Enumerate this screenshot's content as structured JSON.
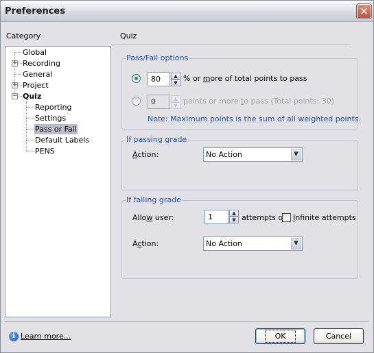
{
  "window": {
    "title": "Preferences",
    "close_icon": "close-icon"
  },
  "category": {
    "label": "Category",
    "items": [
      {
        "label": "Global",
        "level": 0,
        "expander": null
      },
      {
        "label": "Recording",
        "level": 0,
        "expander": "+"
      },
      {
        "label": "General",
        "level": 0,
        "expander": null
      },
      {
        "label": "Project",
        "level": 0,
        "expander": "+"
      },
      {
        "label": "Quiz",
        "level": 0,
        "expander": "-",
        "bold": true
      },
      {
        "label": "Reporting",
        "level": 1
      },
      {
        "label": "Settings",
        "level": 1
      },
      {
        "label": "Pass or Fail",
        "level": 1,
        "selected": true
      },
      {
        "label": "Default Labels",
        "level": 1
      },
      {
        "label": "PENS",
        "level": 1
      }
    ]
  },
  "panel": {
    "title": "Quiz",
    "pass_fail": {
      "title": "Pass/Fail options",
      "percent_option": {
        "selected": true,
        "value": "80",
        "text_pre": "% or ",
        "text_accel": "m",
        "text_post": "ore of total points to pass"
      },
      "points_option": {
        "selected": false,
        "disabled": true,
        "value": "0",
        "text_pre": "points or more ",
        "text_accel": "t",
        "text_post": "o pass (Total points: 30)"
      },
      "note": "Note: Maximum points is the sum of all weighted points."
    },
    "passing": {
      "title": "If passing grade",
      "action_label_accel": "A",
      "action_label_rest": "ction:",
      "action_value": "No Action"
    },
    "failing": {
      "title": "If failing grade",
      "allow_label_pre": "Allo",
      "allow_label_accel": "w",
      "allow_label_post": " user:",
      "attempts_value": "1",
      "attempts_suffix": "attempts or",
      "infinite_checked": false,
      "infinite_accel": "I",
      "infinite_rest": "nfinite attempts",
      "action_label_pre": "A",
      "action_label_accel": "c",
      "action_label_post": "tion:",
      "action_value": "No Action"
    }
  },
  "footer": {
    "learn_more": "Learn more...",
    "ok": "OK",
    "cancel": "Cancel"
  }
}
